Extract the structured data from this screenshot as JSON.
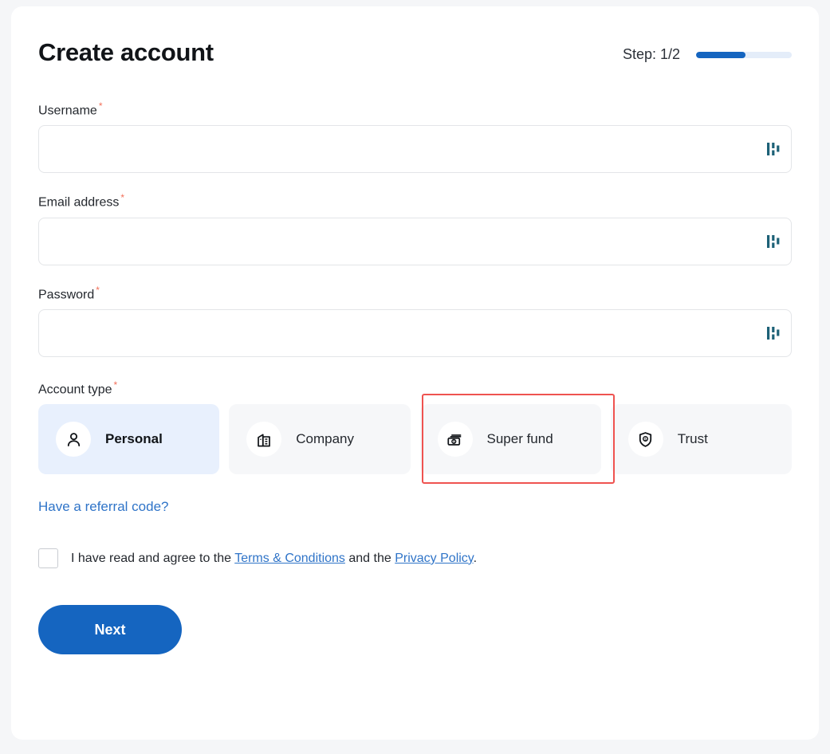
{
  "header": {
    "title": "Create account",
    "step_label": "Step: 1/2",
    "progress_percent": 52
  },
  "fields": [
    {
      "label": "Username",
      "required_mark": "*",
      "value": "",
      "placeholder": "",
      "icon": "signal-bars-icon"
    },
    {
      "label": "Email address",
      "required_mark": "*",
      "value": "",
      "placeholder": "",
      "icon": "signal-bars-icon"
    },
    {
      "label": "Password",
      "required_mark": "*",
      "value": "",
      "placeholder": "",
      "icon": "signal-bars-icon"
    }
  ],
  "account_type": {
    "label": "Account type",
    "required_mark": "*",
    "options": [
      {
        "label": "Personal",
        "icon": "person-icon",
        "selected": true
      },
      {
        "label": "Company",
        "icon": "building-icon",
        "selected": false
      },
      {
        "label": "Super fund",
        "icon": "money-stack-icon",
        "selected": false
      },
      {
        "label": "Trust",
        "icon": "shield-dollar-icon",
        "selected": false
      }
    ]
  },
  "referral": {
    "label": "Have a referral code?"
  },
  "terms": {
    "checked": false,
    "text_before": "I have read and agree to the",
    "link_terms": "Terms & Conditions",
    "text_middle": "and the",
    "link_privacy": "Privacy Policy",
    "text_after": "."
  },
  "submit": {
    "label": "Next"
  },
  "colors": {
    "accent_blue": "#1565c0",
    "link_blue": "#2f74c8",
    "required_star": "#f2705a",
    "annotation_red": "#ef5350",
    "selected_card_bg": "#e8f0fd",
    "card_bg": "#f6f7f9",
    "field_icon_teal": "#1d6177",
    "page_bg": "#f5f6f8"
  }
}
